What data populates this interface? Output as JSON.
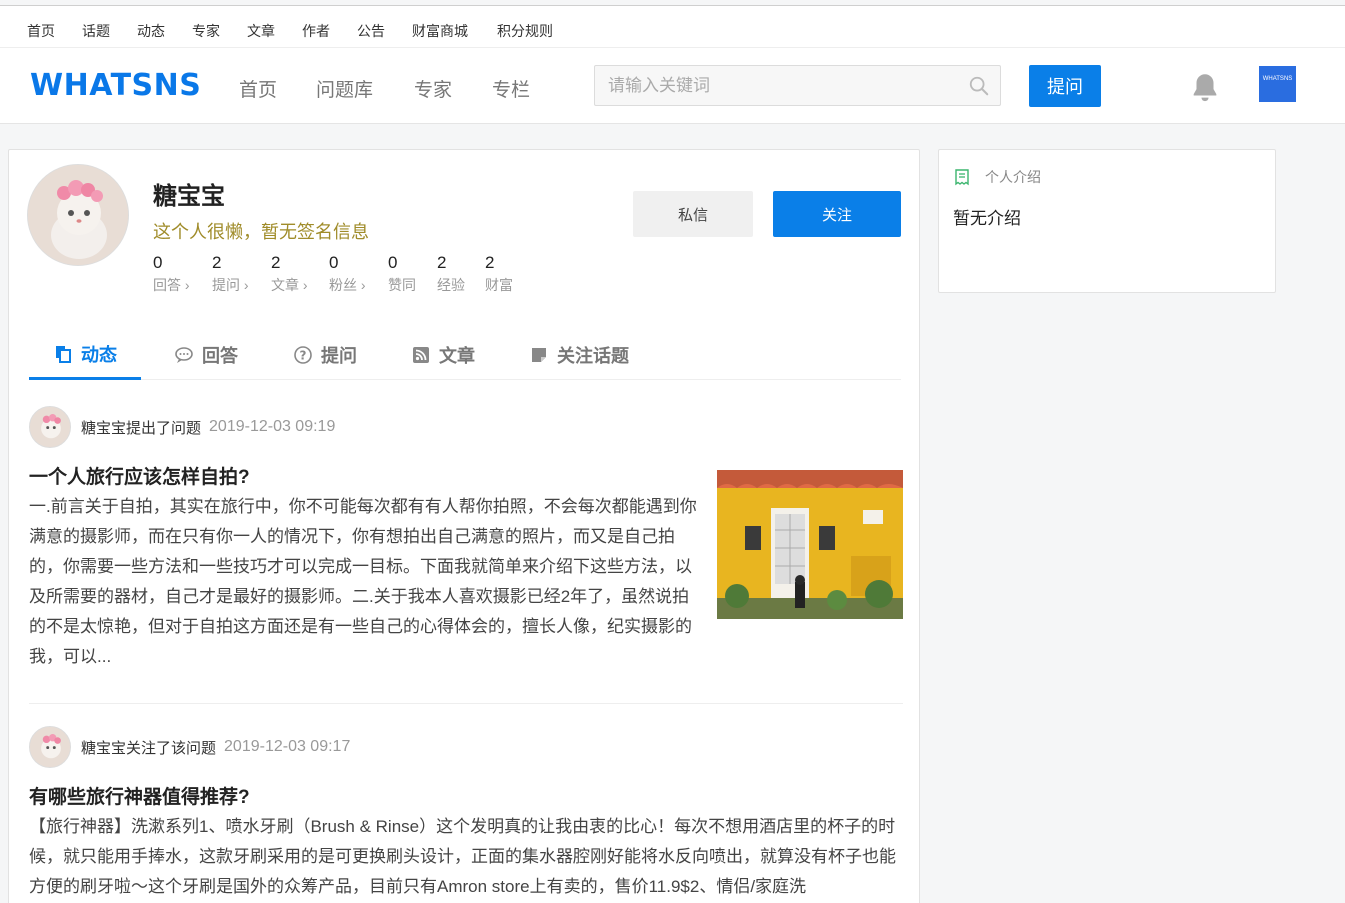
{
  "topnav": [
    "首页",
    "话题",
    "动态",
    "专家",
    "文章",
    "作者",
    "公告",
    "财富商城",
    "积分规则"
  ],
  "header": {
    "logo": "WHATSNS",
    "nav": [
      "首页",
      "问题库",
      "专家",
      "专栏"
    ],
    "search_placeholder": "请输入关键词",
    "ask_label": "提问",
    "avatar_text": "WHATSNS"
  },
  "profile": {
    "name": "糖宝宝",
    "signature": "这个人很懒，暂无签名信息",
    "stats": [
      {
        "value": "0",
        "label": "回答 ›"
      },
      {
        "value": "2",
        "label": "提问 ›"
      },
      {
        "value": "2",
        "label": "文章 ›"
      },
      {
        "value": "0",
        "label": "粉丝 ›"
      },
      {
        "value": "0",
        "label": "赞同"
      },
      {
        "value": "2",
        "label": "经验"
      },
      {
        "value": "2",
        "label": "财富"
      }
    ],
    "pm_label": "私信",
    "follow_label": "关注"
  },
  "tabs": [
    {
      "label": "动态",
      "icon": "copy-icon",
      "active": true
    },
    {
      "label": "回答",
      "icon": "comment-icon",
      "active": false
    },
    {
      "label": "提问",
      "icon": "question-icon",
      "active": false
    },
    {
      "label": "文章",
      "icon": "rss-icon",
      "active": false
    },
    {
      "label": "关注话题",
      "icon": "sticky-note-icon",
      "active": false
    }
  ],
  "feed": [
    {
      "who": "糖宝宝提出了问题",
      "time": "2019-12-03 09:19",
      "title": "一个人旅行应该怎样自拍?",
      "text": "一.前言关于自拍，其实在旅行中，你不可能每次都有有人帮你拍照，不会每次都能遇到你满意的摄影师，而在只有你一人的情况下，你有想拍出自己满意的照片，而又是自己拍的，你需要一些方法和一些技巧才可以完成一目标。下面我就简单来介绍下这些方法，以及所需要的器材，自己才是最好的摄影师。二.关于我本人喜欢摄影已经2年了，虽然说拍的不是太惊艳，但对于自拍这方面还是有一些自己的心得体会的，擅长人像，纪实摄影的我，可以..."
    },
    {
      "who": "糖宝宝关注了该问题",
      "time": "2019-12-03 09:17",
      "title": "有哪些旅行神器值得推荐?",
      "text": "【旅行神器】洗漱系列1、喷水牙刷（Brush & Rinse）这个发明真的让我由衷的比心！每次不想用酒店里的杯子的时候，就只能用手捧水，这款牙刷采用的是可更换刷头设计，正面的集水器腔刚好能将水反向喷出，就算没有杯子也能方便的刷牙啦～这个牙刷是国外的众筹产品，目前只有Amron store上有卖的，售价11.9$2、情侣/家庭洗"
    }
  ],
  "sidebar": {
    "title": "个人介绍",
    "body": "暂无介绍"
  }
}
